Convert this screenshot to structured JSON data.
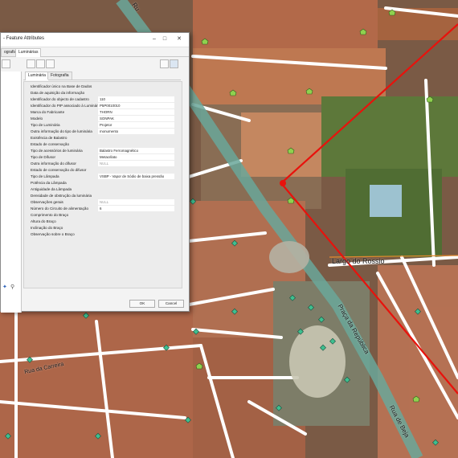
{
  "dialog": {
    "title": "- Feature Attributes",
    "outer_tabs": [
      "ografia",
      "Luminárias"
    ],
    "inner_tabs": [
      "Luminária",
      "Fotografia"
    ],
    "fields": [
      {
        "label": "Identificador único na Base de Dados",
        "value": ""
      },
      {
        "label": "Data de aquisição da informação",
        "value": ""
      },
      {
        "label": "Identificador do objecto de cadastro",
        "value": "110"
      },
      {
        "label": "Identificador do PIP associado à Luminária",
        "value": "P5P0010010"
      },
      {
        "label": "Marca do Fabricante",
        "value": "THORN"
      },
      {
        "label": "Modelo",
        "value": "SONPAK"
      },
      {
        "label": "Tipo de Luminária",
        "value": "Projetor"
      },
      {
        "label": "Outra informação do tipo de luminária",
        "value": "monumento"
      },
      {
        "label": "Existência de Balastro",
        "value": ""
      },
      {
        "label": "Estado de conservação",
        "value": ""
      },
      {
        "label": "Tipo de acessórios de luminária",
        "value": "Balastro Ferromagnético"
      },
      {
        "label": "Tipo de Difusor",
        "value": "Metacrilato"
      },
      {
        "label": "Outra informação do difusor",
        "value": "",
        "placeholder": "NULL"
      },
      {
        "label": "Estado de conservação do difusor",
        "value": ""
      },
      {
        "label": "Tipo de Lâmpada",
        "value": "VSBP - Vapor de Sódio de baixa pressão"
      },
      {
        "label": "Potência da Lâmpada",
        "value": ""
      },
      {
        "label": "Antiguidade da Lâmpada",
        "value": ""
      },
      {
        "label": "Densidade de obstrução da luminária",
        "value": ""
      },
      {
        "label": "Observações gerais",
        "value": "",
        "placeholder": "NULL"
      },
      {
        "label": "Número do Circuito de alimentação",
        "value": "6"
      },
      {
        "label": "Comprimento do Braço",
        "value": ""
      },
      {
        "label": "Altura do Braço",
        "value": ""
      },
      {
        "label": "Inclinação do Braço",
        "value": ""
      },
      {
        "label": "Observação sobre o Braço",
        "value": ""
      }
    ],
    "ok_label": "OK",
    "cancel_label": "Cancel"
  },
  "map": {
    "street_labels": [
      "Largo do Rossio",
      "Praça da República",
      "Rua de Beja",
      "Rua da Carreira",
      "Ru"
    ]
  },
  "colors": {
    "line_accent": "#e8120c",
    "point_marker": "#3fbf8f",
    "poi_marker": "#8fd14f",
    "road": "#ffffff",
    "main_road": "#6aa79a"
  }
}
